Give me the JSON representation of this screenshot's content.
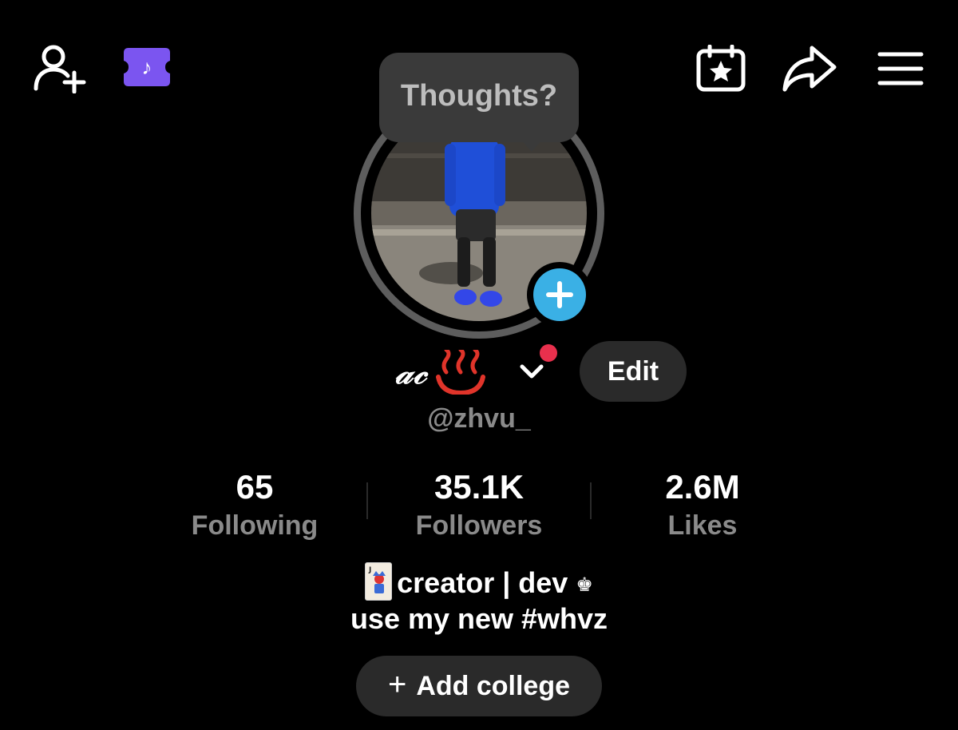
{
  "header": {
    "add_friend_icon": "person-plus-icon",
    "ticket_icon": "tiktok-ticket-icon",
    "ticket_glyph": "♪",
    "calendar_icon": "calendar-star-icon",
    "share_icon": "share-arrow-icon",
    "menu_icon": "hamburger-menu-icon",
    "accent_purple": "#6d4cf0"
  },
  "tooltip": {
    "text": "Thoughts?"
  },
  "profile": {
    "display_name": "𝒶𝒸",
    "name_emoji": "onsen-icon",
    "handle": "@zhvu_",
    "edit_label": "Edit",
    "add_story_color": "#3ab0e5",
    "notification_color": "#e8304d"
  },
  "stats": [
    {
      "value": "65",
      "label": "Following"
    },
    {
      "value": "35.1K",
      "label": "Followers"
    },
    {
      "value": "2.6M",
      "label": "Likes"
    }
  ],
  "bio": {
    "line1_icon": "joker-card-icon",
    "line1_text": "creator | dev",
    "line1_suffix": "♚",
    "line2": "use my new #whvz"
  },
  "college_button": {
    "label": "Add college",
    "icon": "+"
  }
}
